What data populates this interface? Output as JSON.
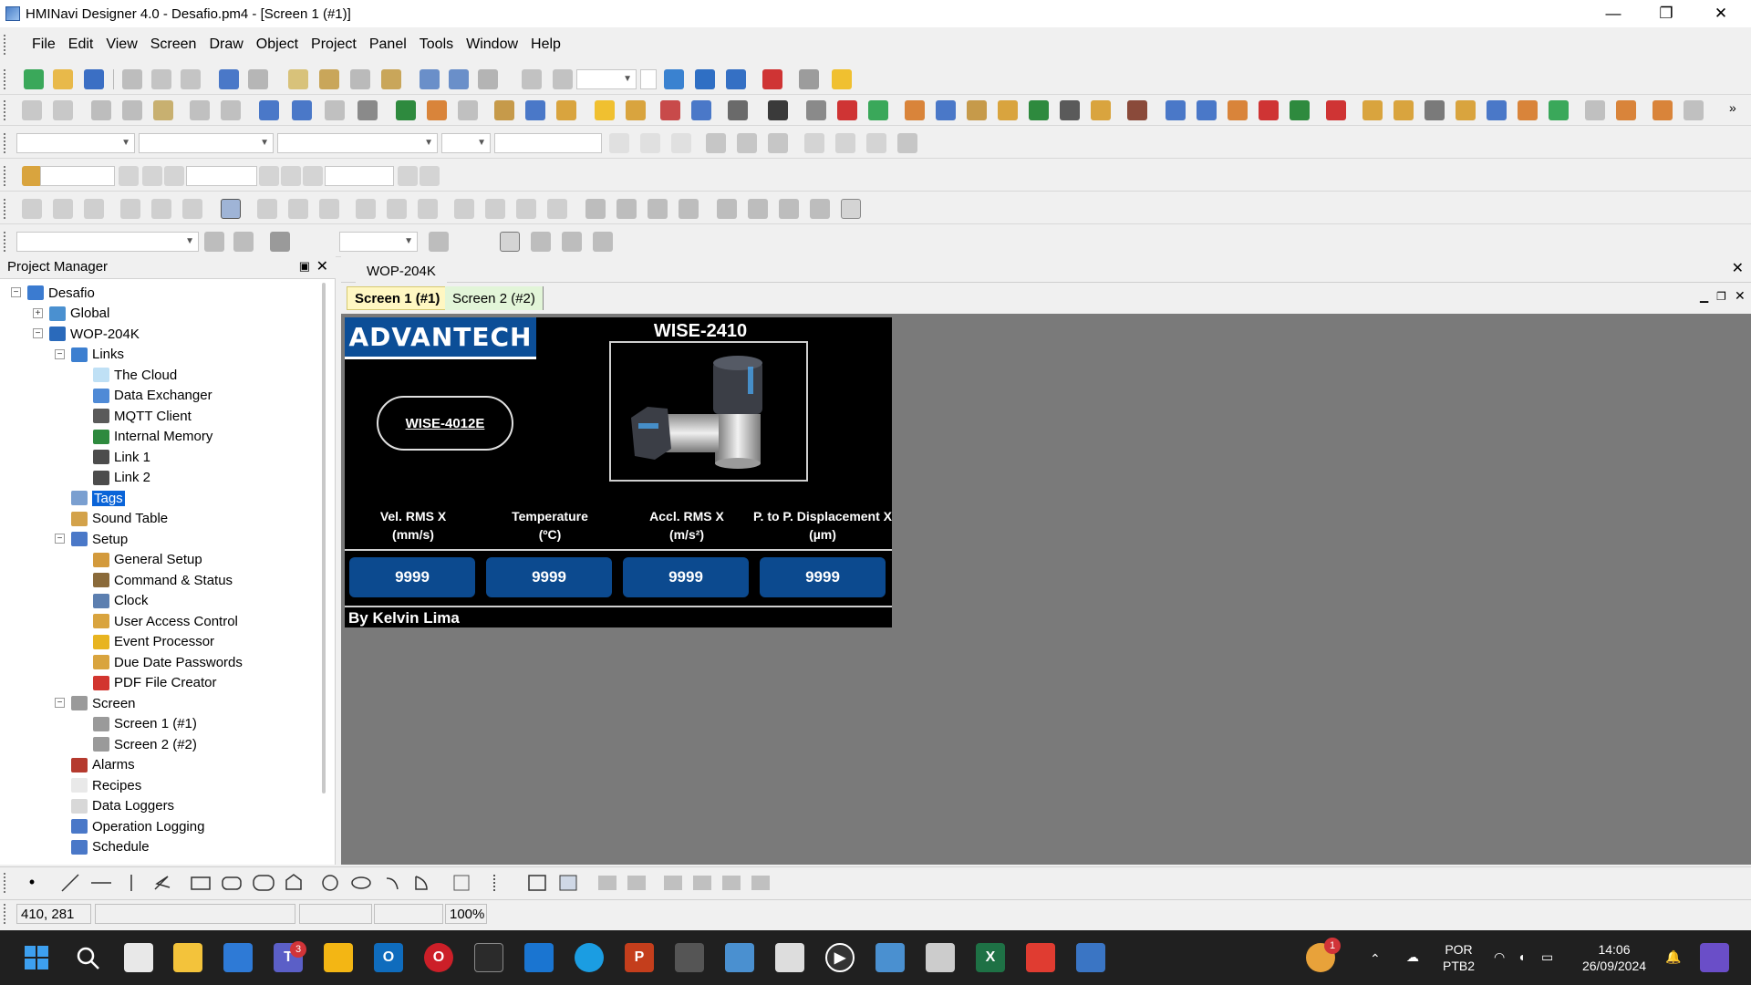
{
  "window": {
    "title": "HMINavi Designer 4.0 - Desafio.pm4 - [Screen 1 (#1)]",
    "minimize": "—",
    "restore": "❐",
    "close": "✕"
  },
  "menu": [
    "File",
    "Edit",
    "View",
    "Screen",
    "Draw",
    "Object",
    "Project",
    "Panel",
    "Tools",
    "Window",
    "Help"
  ],
  "project_manager": {
    "title": "Project Manager",
    "pin": "▣",
    "close": "✕",
    "tree": [
      {
        "label": "Desafio",
        "icon": "project-icon",
        "color": "#3b7bd0"
      },
      {
        "label": "Global",
        "icon": "globe-icon",
        "color": "#4a90d0"
      },
      {
        "label": "WOP-204K",
        "icon": "panel-icon",
        "color": "#2a6abb"
      },
      {
        "label": "Links",
        "icon": "network-icon",
        "color": "#3c7fd0"
      },
      {
        "label": "The Cloud",
        "icon": "cloud-icon",
        "color": "#bfe0f5"
      },
      {
        "label": "Data Exchanger",
        "icon": "exchange-icon",
        "color": "#4f8ad6"
      },
      {
        "label": "MQTT Client",
        "icon": "mqtt-icon",
        "color": "#5a5a5a"
      },
      {
        "label": "Internal Memory",
        "icon": "memory-icon",
        "color": "#2e8a3e"
      },
      {
        "label": "Link 1",
        "icon": "link-icon",
        "color": "#4c4c4c"
      },
      {
        "label": "Link 2",
        "icon": "link-icon",
        "color": "#4c4c4c"
      },
      {
        "label": "Tags",
        "icon": "tag-icon",
        "color": "#7a9fd0"
      },
      {
        "label": "Sound Table",
        "icon": "sound-icon",
        "color": "#d3a24a"
      },
      {
        "label": "Setup",
        "icon": "setup-icon",
        "color": "#4a78c8"
      },
      {
        "label": "General Setup",
        "icon": "settings-icon",
        "color": "#d39a3c"
      },
      {
        "label": "Command & Status",
        "icon": "command-icon",
        "color": "#8a6a3a"
      },
      {
        "label": "Clock",
        "icon": "clock-icon",
        "color": "#5c7fb0"
      },
      {
        "label": "User Access Control",
        "icon": "user-icon",
        "color": "#d9a43e"
      },
      {
        "label": "Event Processor",
        "icon": "lightning-icon",
        "color": "#e8b420"
      },
      {
        "label": "Due Date Passwords",
        "icon": "password-icon",
        "color": "#d9a43e"
      },
      {
        "label": "PDF File Creator",
        "icon": "pdf-icon",
        "color": "#d2352f"
      },
      {
        "label": "Screen",
        "icon": "screen-icon",
        "color": "#9a9a9a"
      },
      {
        "label": "Screen 1 (#1)",
        "icon": "screen-page-icon",
        "color": "#9a9a9a"
      },
      {
        "label": "Screen 2 (#2)",
        "icon": "screen-page-icon",
        "color": "#9a9a9a"
      },
      {
        "label": "Alarms",
        "icon": "alarm-icon",
        "color": "#b53a2e"
      },
      {
        "label": "Recipes",
        "icon": "recipe-icon",
        "color": "#e9e9e9"
      },
      {
        "label": "Data Loggers",
        "icon": "logger-icon",
        "color": "#d8d8d8"
      },
      {
        "label": "Operation Logging",
        "icon": "operation-log-icon",
        "color": "#4a78c8"
      },
      {
        "label": "Schedule",
        "icon": "schedule-icon",
        "color": "#4a78c8"
      }
    ]
  },
  "document": {
    "panel_tab": "WOP-204K",
    "close": "✕",
    "screen_tabs": [
      {
        "label": "Screen 1 (#1)",
        "active": true
      },
      {
        "label": "Screen 2 (#2)",
        "active": false
      }
    ]
  },
  "hmi_screen": {
    "logo_text": "ADVANTECH",
    "product_title": "WISE-2410",
    "device_button": "WISE-4012E",
    "columns": [
      {
        "label_line1": "Vel. RMS X",
        "label_line2": "(mm/s)",
        "value": "9999"
      },
      {
        "label_line1": "Temperature",
        "label_line2": "(ºC)",
        "value": "9999"
      },
      {
        "label_line1": "Accl. RMS X",
        "label_line2": "(m/s²)",
        "value": "9999"
      },
      {
        "label_line1": "P. to P. Displacement X",
        "label_line2": "(µm)",
        "value": "9999"
      }
    ],
    "author": "By Kelvin Lima"
  },
  "status": {
    "coordinates": "410, 281",
    "zoom": "100%"
  },
  "taskbar": {
    "teams_badge": "3",
    "tray_badge": "1",
    "language_line1": "POR",
    "language_line2": "PTB2",
    "time": "14:06",
    "date": "26/09/2024"
  },
  "colors": {
    "accent_blue": "#0c4e97",
    "value_box": "#0c4a8f",
    "canvas_bg": "#7a7a7a",
    "selected": "#0a64d8"
  }
}
